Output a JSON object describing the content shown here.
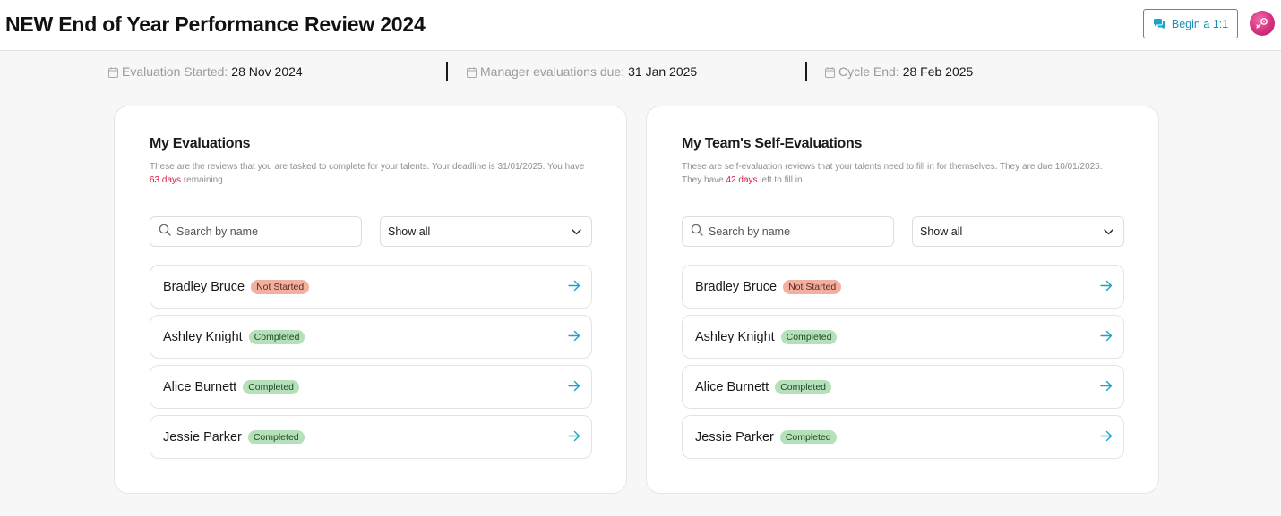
{
  "header": {
    "title": "NEW End of Year Performance Review 2024",
    "begin_button": "Begin a 1:1",
    "accent": "#1aa3c9"
  },
  "dates": [
    {
      "label": "Evaluation Started:",
      "value": "28 Nov 2024"
    },
    {
      "label": "Manager evaluations due:",
      "value": "31 Jan 2025"
    },
    {
      "label": "Cycle End:",
      "value": "28 Feb 2025"
    }
  ],
  "panels": [
    {
      "title": "My Evaluations",
      "desc_before": "These are the reviews that you are tasked to complete for your talents. Your deadline is 31/01/2025. You have ",
      "desc_days": "63 days",
      "desc_after": " remaining.",
      "search_placeholder": "Search by name",
      "filter": "Show all",
      "rows": [
        {
          "name": "Bradley Bruce",
          "status": "Not Started"
        },
        {
          "name": "Ashley Knight",
          "status": "Completed"
        },
        {
          "name": "Alice Burnett",
          "status": "Completed"
        },
        {
          "name": "Jessie Parker",
          "status": "Completed"
        }
      ]
    },
    {
      "title": "My Team's Self-Evaluations",
      "desc_before": "These are self-evaluation reviews that your talents need to fill in for themselves. They are due 10/01/2025. They have ",
      "desc_days": "42 days",
      "desc_after": " left to fill in.",
      "search_placeholder": "Search by name",
      "filter": "Show all",
      "rows": [
        {
          "name": "Bradley Bruce",
          "status": "Not Started"
        },
        {
          "name": "Ashley Knight",
          "status": "Completed"
        },
        {
          "name": "Alice Burnett",
          "status": "Completed"
        },
        {
          "name": "Jessie Parker",
          "status": "Completed"
        }
      ]
    }
  ],
  "colors": {
    "not_started": "#f3b0a0",
    "completed": "#b5e0b9",
    "days_highlight": "#d81b4a",
    "arrow": "#1aa3c9"
  },
  "icons": [
    "chat-icon",
    "avatar-icon",
    "calendar-icon",
    "search-icon",
    "chevron-down-icon",
    "arrow-right-icon"
  ]
}
